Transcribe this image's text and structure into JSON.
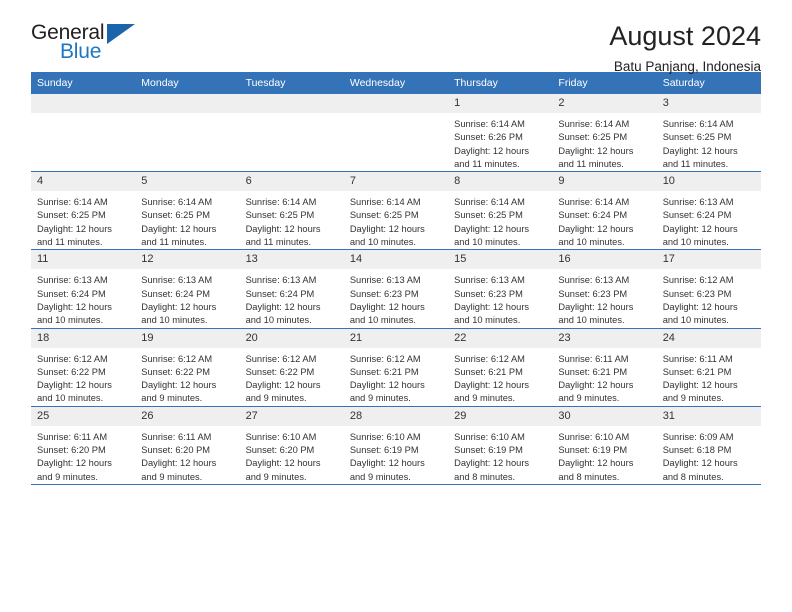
{
  "logo": {
    "word_one": "General",
    "word_two": "Blue",
    "triangle_color": "#1b63ab",
    "blue_color": "#1f77c2"
  },
  "header": {
    "title": "August 2024",
    "subtitle": "Batu Panjang, Indonesia"
  },
  "theme": {
    "header_blue": "#3573b9",
    "daynum_gray": "#efefef"
  },
  "weekday_headers": [
    "Sunday",
    "Monday",
    "Tuesday",
    "Wednesday",
    "Thursday",
    "Friday",
    "Saturday"
  ],
  "weeks": [
    [
      {
        "day": "",
        "blank": true,
        "sunrise": "",
        "sunset": "",
        "daylight1": "",
        "daylight2": ""
      },
      {
        "day": "",
        "blank": true,
        "sunrise": "",
        "sunset": "",
        "daylight1": "",
        "daylight2": ""
      },
      {
        "day": "",
        "blank": true,
        "sunrise": "",
        "sunset": "",
        "daylight1": "",
        "daylight2": ""
      },
      {
        "day": "",
        "blank": true,
        "sunrise": "",
        "sunset": "",
        "daylight1": "",
        "daylight2": ""
      },
      {
        "day": "1",
        "sunrise": "Sunrise: 6:14 AM",
        "sunset": "Sunset: 6:26 PM",
        "daylight1": "Daylight: 12 hours",
        "daylight2": "and 11 minutes."
      },
      {
        "day": "2",
        "sunrise": "Sunrise: 6:14 AM",
        "sunset": "Sunset: 6:25 PM",
        "daylight1": "Daylight: 12 hours",
        "daylight2": "and 11 minutes."
      },
      {
        "day": "3",
        "sunrise": "Sunrise: 6:14 AM",
        "sunset": "Sunset: 6:25 PM",
        "daylight1": "Daylight: 12 hours",
        "daylight2": "and 11 minutes."
      }
    ],
    [
      {
        "day": "4",
        "sunrise": "Sunrise: 6:14 AM",
        "sunset": "Sunset: 6:25 PM",
        "daylight1": "Daylight: 12 hours",
        "daylight2": "and 11 minutes."
      },
      {
        "day": "5",
        "sunrise": "Sunrise: 6:14 AM",
        "sunset": "Sunset: 6:25 PM",
        "daylight1": "Daylight: 12 hours",
        "daylight2": "and 11 minutes."
      },
      {
        "day": "6",
        "sunrise": "Sunrise: 6:14 AM",
        "sunset": "Sunset: 6:25 PM",
        "daylight1": "Daylight: 12 hours",
        "daylight2": "and 11 minutes."
      },
      {
        "day": "7",
        "sunrise": "Sunrise: 6:14 AM",
        "sunset": "Sunset: 6:25 PM",
        "daylight1": "Daylight: 12 hours",
        "daylight2": "and 10 minutes."
      },
      {
        "day": "8",
        "sunrise": "Sunrise: 6:14 AM",
        "sunset": "Sunset: 6:25 PM",
        "daylight1": "Daylight: 12 hours",
        "daylight2": "and 10 minutes."
      },
      {
        "day": "9",
        "sunrise": "Sunrise: 6:14 AM",
        "sunset": "Sunset: 6:24 PM",
        "daylight1": "Daylight: 12 hours",
        "daylight2": "and 10 minutes."
      },
      {
        "day": "10",
        "sunrise": "Sunrise: 6:13 AM",
        "sunset": "Sunset: 6:24 PM",
        "daylight1": "Daylight: 12 hours",
        "daylight2": "and 10 minutes."
      }
    ],
    [
      {
        "day": "11",
        "sunrise": "Sunrise: 6:13 AM",
        "sunset": "Sunset: 6:24 PM",
        "daylight1": "Daylight: 12 hours",
        "daylight2": "and 10 minutes."
      },
      {
        "day": "12",
        "sunrise": "Sunrise: 6:13 AM",
        "sunset": "Sunset: 6:24 PM",
        "daylight1": "Daylight: 12 hours",
        "daylight2": "and 10 minutes."
      },
      {
        "day": "13",
        "sunrise": "Sunrise: 6:13 AM",
        "sunset": "Sunset: 6:24 PM",
        "daylight1": "Daylight: 12 hours",
        "daylight2": "and 10 minutes."
      },
      {
        "day": "14",
        "sunrise": "Sunrise: 6:13 AM",
        "sunset": "Sunset: 6:23 PM",
        "daylight1": "Daylight: 12 hours",
        "daylight2": "and 10 minutes."
      },
      {
        "day": "15",
        "sunrise": "Sunrise: 6:13 AM",
        "sunset": "Sunset: 6:23 PM",
        "daylight1": "Daylight: 12 hours",
        "daylight2": "and 10 minutes."
      },
      {
        "day": "16",
        "sunrise": "Sunrise: 6:13 AM",
        "sunset": "Sunset: 6:23 PM",
        "daylight1": "Daylight: 12 hours",
        "daylight2": "and 10 minutes."
      },
      {
        "day": "17",
        "sunrise": "Sunrise: 6:12 AM",
        "sunset": "Sunset: 6:23 PM",
        "daylight1": "Daylight: 12 hours",
        "daylight2": "and 10 minutes."
      }
    ],
    [
      {
        "day": "18",
        "sunrise": "Sunrise: 6:12 AM",
        "sunset": "Sunset: 6:22 PM",
        "daylight1": "Daylight: 12 hours",
        "daylight2": "and 10 minutes."
      },
      {
        "day": "19",
        "sunrise": "Sunrise: 6:12 AM",
        "sunset": "Sunset: 6:22 PM",
        "daylight1": "Daylight: 12 hours",
        "daylight2": "and 9 minutes."
      },
      {
        "day": "20",
        "sunrise": "Sunrise: 6:12 AM",
        "sunset": "Sunset: 6:22 PM",
        "daylight1": "Daylight: 12 hours",
        "daylight2": "and 9 minutes."
      },
      {
        "day": "21",
        "sunrise": "Sunrise: 6:12 AM",
        "sunset": "Sunset: 6:21 PM",
        "daylight1": "Daylight: 12 hours",
        "daylight2": "and 9 minutes."
      },
      {
        "day": "22",
        "sunrise": "Sunrise: 6:12 AM",
        "sunset": "Sunset: 6:21 PM",
        "daylight1": "Daylight: 12 hours",
        "daylight2": "and 9 minutes."
      },
      {
        "day": "23",
        "sunrise": "Sunrise: 6:11 AM",
        "sunset": "Sunset: 6:21 PM",
        "daylight1": "Daylight: 12 hours",
        "daylight2": "and 9 minutes."
      },
      {
        "day": "24",
        "sunrise": "Sunrise: 6:11 AM",
        "sunset": "Sunset: 6:21 PM",
        "daylight1": "Daylight: 12 hours",
        "daylight2": "and 9 minutes."
      }
    ],
    [
      {
        "day": "25",
        "sunrise": "Sunrise: 6:11 AM",
        "sunset": "Sunset: 6:20 PM",
        "daylight1": "Daylight: 12 hours",
        "daylight2": "and 9 minutes."
      },
      {
        "day": "26",
        "sunrise": "Sunrise: 6:11 AM",
        "sunset": "Sunset: 6:20 PM",
        "daylight1": "Daylight: 12 hours",
        "daylight2": "and 9 minutes."
      },
      {
        "day": "27",
        "sunrise": "Sunrise: 6:10 AM",
        "sunset": "Sunset: 6:20 PM",
        "daylight1": "Daylight: 12 hours",
        "daylight2": "and 9 minutes."
      },
      {
        "day": "28",
        "sunrise": "Sunrise: 6:10 AM",
        "sunset": "Sunset: 6:19 PM",
        "daylight1": "Daylight: 12 hours",
        "daylight2": "and 9 minutes."
      },
      {
        "day": "29",
        "sunrise": "Sunrise: 6:10 AM",
        "sunset": "Sunset: 6:19 PM",
        "daylight1": "Daylight: 12 hours",
        "daylight2": "and 8 minutes."
      },
      {
        "day": "30",
        "sunrise": "Sunrise: 6:10 AM",
        "sunset": "Sunset: 6:19 PM",
        "daylight1": "Daylight: 12 hours",
        "daylight2": "and 8 minutes."
      },
      {
        "day": "31",
        "sunrise": "Sunrise: 6:09 AM",
        "sunset": "Sunset: 6:18 PM",
        "daylight1": "Daylight: 12 hours",
        "daylight2": "and 8 minutes."
      }
    ]
  ]
}
